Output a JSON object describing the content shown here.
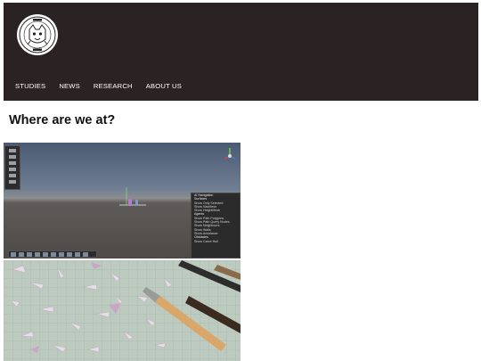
{
  "header": {
    "logo_alt": "club logo",
    "nav": [
      {
        "label": "STUDIES"
      },
      {
        "label": "NEWS"
      },
      {
        "label": "RESEARCH"
      },
      {
        "label": "ABOUT US"
      }
    ]
  },
  "main": {
    "heading": "Where are we at?"
  },
  "editor_panel": {
    "lines": [
      "AI Navigation",
      "Surfaces",
      "Show Only Selected",
      "Show NavMesh",
      "Show HeightMesh",
      "Agents",
      "Show Path Polygons",
      "Show Path Query Nodes",
      "Show Neighbours",
      "Show Walls",
      "Show Avoidance",
      "Obstacles",
      "Show Carve Hull"
    ]
  },
  "colors": {
    "header_bg": "#2b2224",
    "nav_text": "#ffffff",
    "heading_text": "#111111"
  }
}
